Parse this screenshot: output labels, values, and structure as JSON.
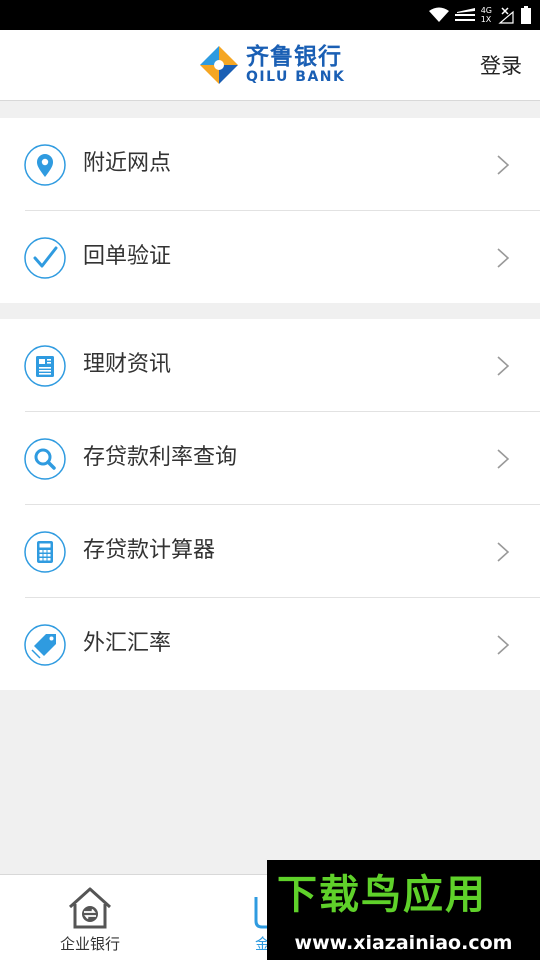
{
  "status_bar": {
    "network_label": "4G",
    "network_sub": "1X"
  },
  "header": {
    "logo_cn": "齐鲁银行",
    "logo_en": "QILU BANK",
    "login_label": "登录"
  },
  "menu_groups": [
    {
      "items": [
        {
          "label": "附近网点",
          "icon": "location-pin-icon"
        },
        {
          "label": "回单验证",
          "icon": "checkmark-icon"
        }
      ]
    },
    {
      "items": [
        {
          "label": "理财资讯",
          "icon": "newspaper-icon"
        },
        {
          "label": "存贷款利率查询",
          "icon": "search-icon"
        },
        {
          "label": "存贷款计算器",
          "icon": "calculator-icon"
        },
        {
          "label": "外汇汇率",
          "icon": "price-tag-icon"
        }
      ]
    }
  ],
  "tabbar": {
    "tabs": [
      {
        "label": "企业银行",
        "icon": "house-exchange-icon",
        "active": false
      },
      {
        "label": "金融",
        "icon": "finance-icon",
        "active": true
      }
    ]
  },
  "watermark": {
    "title": "下载鸟应用",
    "url": "www.xiazainiao.com"
  },
  "colors": {
    "accent": "#2f9be0",
    "brand": "#1a5fb4",
    "logo_orange": "#f5a623",
    "watermark_green": "#5fd12a"
  }
}
